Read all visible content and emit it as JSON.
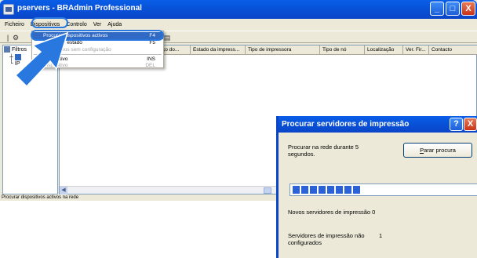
{
  "window": {
    "title": "pservers - BRAdmin Professional",
    "min_glyph": "_",
    "max_glyph": "□",
    "close_glyph": "X"
  },
  "menubar": {
    "items": [
      "Ficheiro",
      "Dispositivos",
      "Controlo",
      "Ver",
      "Ajuda"
    ]
  },
  "tree": {
    "root_label": "Filtros",
    "child1": "",
    "child2": "IP"
  },
  "list": {
    "columns": [
      "ço do...",
      "Estado da impress...",
      "Tipo de impressora",
      "Tipo de nó",
      "Localização",
      "Ver. Fir...",
      "Contacto"
    ]
  },
  "dropdown": {
    "items": [
      {
        "label": "Procurar dispositivos activos",
        "shortcut": "F4"
      },
      {
        "label": "Actualizar estado",
        "shortcut": "F5"
      },
      {
        "label": "dispositivos sem configuração",
        "shortcut": ""
      },
      {
        "label": "Dispositivo",
        "shortcut": "INS"
      },
      {
        "label": "Dispositivo",
        "shortcut": "DEL"
      }
    ]
  },
  "statusbar": {
    "text": "Procurar dispositivos activos na rede"
  },
  "dialog": {
    "title": "Procurar servidores de impressão",
    "help_glyph": "?",
    "close_glyph": "X",
    "search_text_line1": "Procurar na rede durante 5",
    "search_text_line2": "segundos.",
    "stop_button": "Parar procura",
    "new_servers_label": "Novos servidores de impressão",
    "new_servers_count": "0",
    "unconfigured_label_line1": "Servidores de impressão não",
    "unconfigured_label_line2": "configurados",
    "unconfigured_count": "1",
    "progress_blocks": 8
  },
  "colors": {
    "xp_blue": "#0a45c8",
    "highlight": "#316ac5",
    "ring": "#2878e0",
    "progress": "#2c62d8"
  }
}
